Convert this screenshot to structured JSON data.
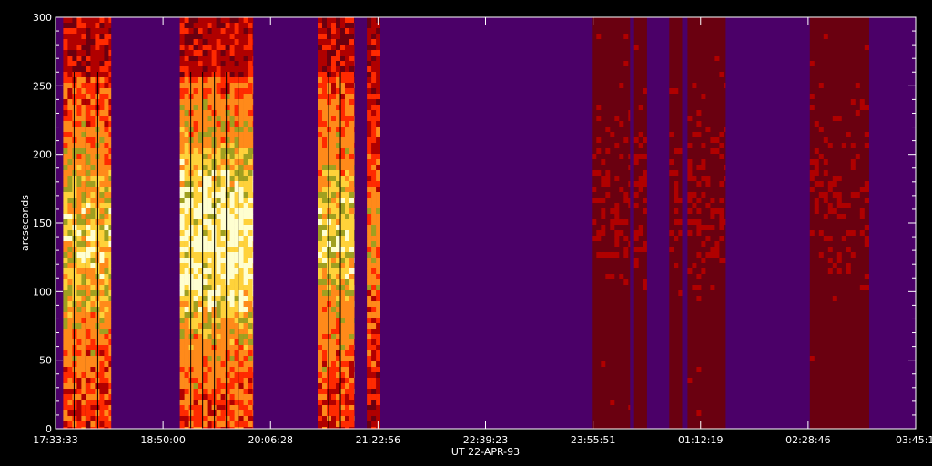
{
  "chart_data": {
    "type": "heatmap",
    "title": "",
    "xlabel": "UT  22-APR-93",
    "ylabel": "arcseconds",
    "x_ticks": [
      "17:33:33",
      "18:50:00",
      "20:06:28",
      "21:22:56",
      "22:39:23",
      "23:55:51",
      "01:12:19",
      "02:28:46",
      "03:45:14"
    ],
    "y_ticks": [
      0,
      50,
      100,
      150,
      200,
      250,
      300
    ],
    "ylim": [
      0,
      300
    ],
    "x_range": [
      "17:33:33",
      "03:45:14"
    ],
    "background_color": "#4b0068",
    "colormap": [
      "#4b0068",
      "#6a0010",
      "#b00000",
      "#ff2a00",
      "#ff8a1a",
      "#ffd23a",
      "#ffffd0",
      "#a0a020"
    ],
    "observation_intervals": [
      {
        "start": "17:39",
        "end": "18:13",
        "profile": "bright"
      },
      {
        "start": "19:02",
        "end": "19:54",
        "profile": "brightest"
      },
      {
        "start": "20:40",
        "end": "21:06",
        "profile": "bright"
      },
      {
        "start": "21:15",
        "end": "21:24",
        "profile": "medium"
      },
      {
        "start": "23:55",
        "end": "00:22",
        "profile": "dim"
      },
      {
        "start": "00:25",
        "end": "00:34",
        "profile": "dim"
      },
      {
        "start": "00:50",
        "end": "00:59",
        "profile": "dim"
      },
      {
        "start": "01:03",
        "end": "01:30",
        "profile": "dim"
      },
      {
        "start": "02:30",
        "end": "03:12",
        "profile": "dim"
      }
    ]
  }
}
